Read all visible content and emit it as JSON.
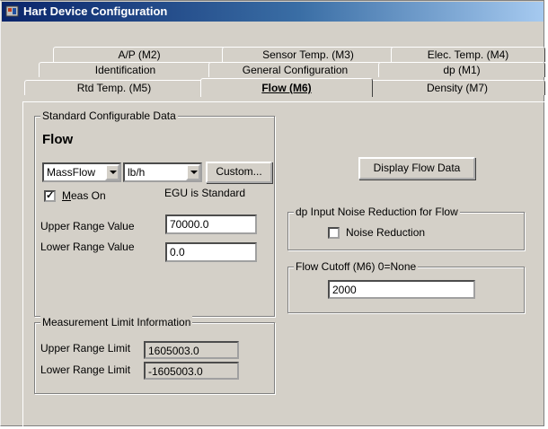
{
  "window": {
    "title": "Hart Device Configuration"
  },
  "tabs": {
    "row1": [
      "A/P (M2)",
      "Sensor Temp. (M3)",
      "Elec. Temp. (M4)"
    ],
    "row2": [
      "Identification",
      "General Configuration",
      "dp (M1)"
    ],
    "row3": [
      "Rtd Temp. (M5)",
      "Flow (M6)",
      "Density (M7)"
    ]
  },
  "standard": {
    "legend": "Standard Configurable Data",
    "heading": "Flow",
    "variable": "MassFlow",
    "unit": "lb/h",
    "custom_button": "Custom...",
    "meas_on_prefix": "M",
    "meas_on_rest": "eas On",
    "meas_on_checked": true,
    "egu_text": "EGU is Standard",
    "upper_label": "Upper Range Value",
    "upper_value": "70000.0",
    "lower_label": "Lower Range Value",
    "lower_value": "0.0"
  },
  "limits": {
    "legend": "Measurement Limit Information",
    "upper_label": "Upper Range Limit",
    "upper_value": "1605003.0",
    "lower_label": "Lower Range Limit",
    "lower_value": "-1605003.0"
  },
  "display_button": "Display Flow Data",
  "noise": {
    "legend": "dp Input Noise Reduction for Flow",
    "label": "Noise Reduction",
    "checked": false
  },
  "cutoff": {
    "legend": "Flow Cutoff (M6)  0=None",
    "value": "2000"
  }
}
